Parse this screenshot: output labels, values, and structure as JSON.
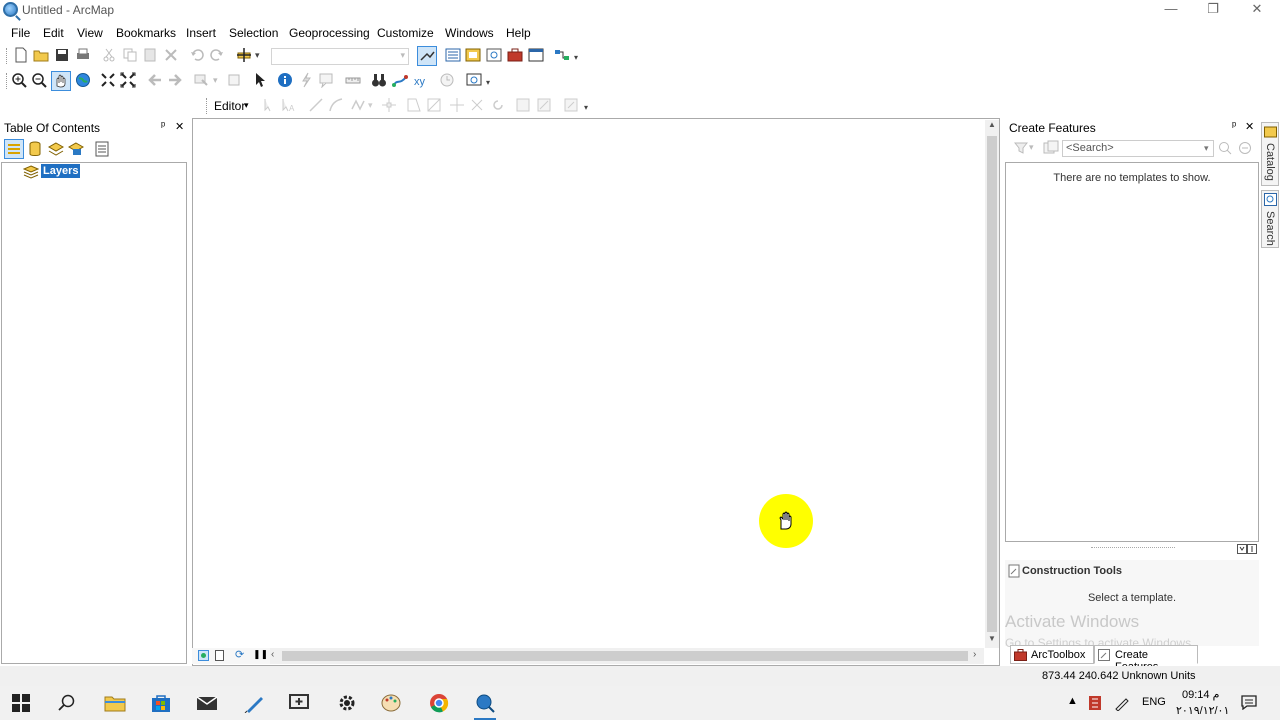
{
  "window": {
    "title": "Untitled - ArcMap",
    "minimize": "—",
    "maximize": "❐",
    "close": "✕"
  },
  "menu": [
    "File",
    "Edit",
    "View",
    "Bookmarks",
    "Insert",
    "Selection",
    "Geoprocessing",
    "Customize",
    "Windows",
    "Help"
  ],
  "editor_toolbar": {
    "editor_label": "Editor",
    "dropdown_arrow": "▾"
  },
  "toc": {
    "title": "Table Of Contents",
    "pin": "ᵖ",
    "close": "✕",
    "root_layer": "Layers"
  },
  "create_features": {
    "title": "Create Features",
    "pin": "ᵖ",
    "close": "✕",
    "search_placeholder": "<Search>",
    "empty_message": "There are no templates to show.",
    "construction_tools_title": "Construction Tools",
    "construction_tools_message": "Select a template."
  },
  "side_tabs": [
    "Catalog",
    "Search"
  ],
  "bottom_tabs": [
    "ArcToolbox",
    "Create Features"
  ],
  "status": {
    "coordinates": "873.44  240.642 Unknown Units"
  },
  "watermark": {
    "title": "Activate Windows",
    "subtitle": "Go to Settings to activate Windows."
  },
  "taskbar": {
    "language": "ENG",
    "time": "09:14 م",
    "date": "۲۰۱۹/۱۲/۰۱"
  },
  "icons": {
    "app": "arcmap-globe-icon",
    "accent_blue": "#2b79c4",
    "highlight_yellow": "#ffff00"
  }
}
